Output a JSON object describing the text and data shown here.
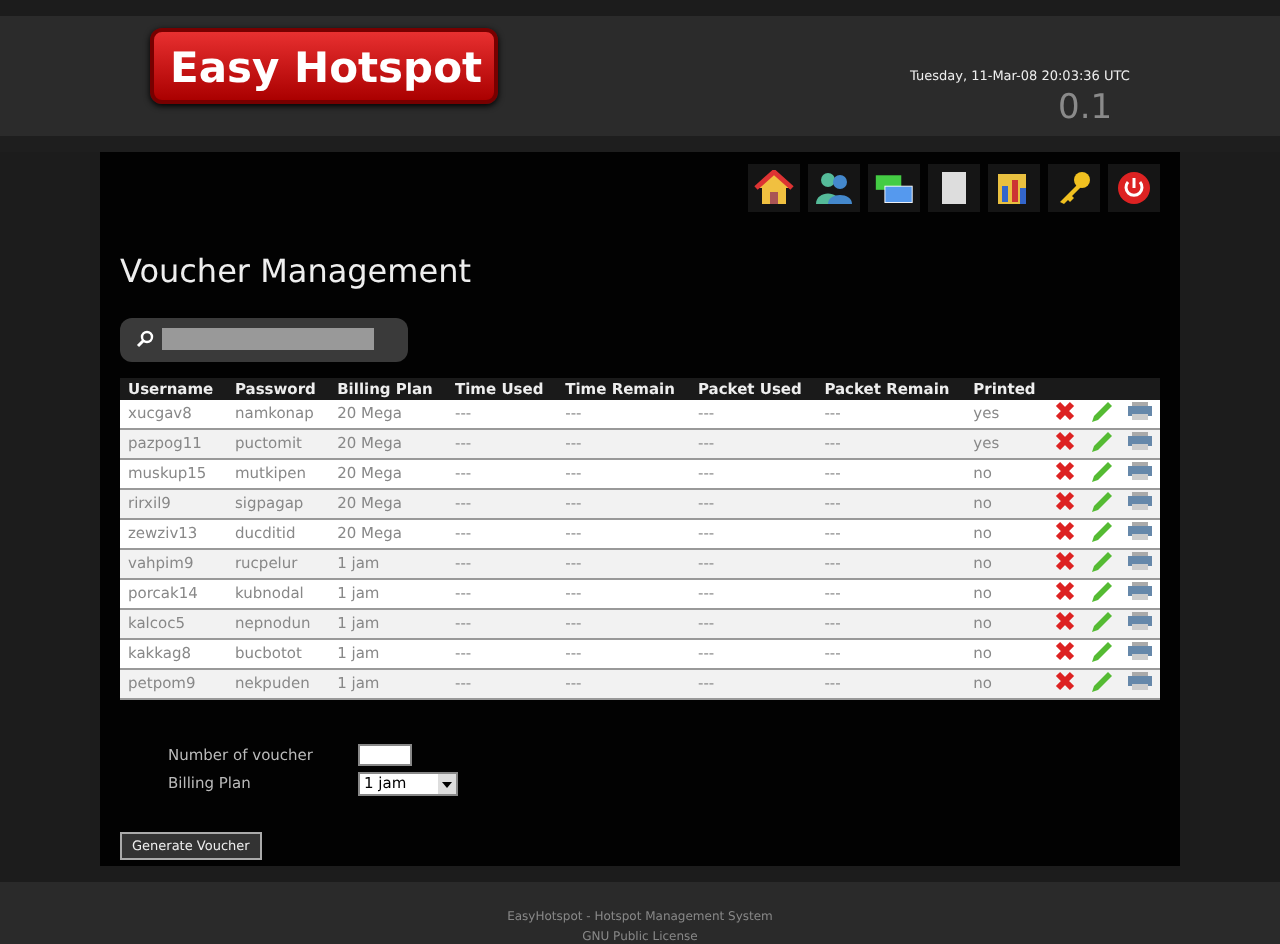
{
  "header": {
    "logo": "Easy Hotspot",
    "datetime": "Tuesday, 11-Mar-08 20:03:36 UTC",
    "version": "0.1"
  },
  "page_title": "Voucher Management",
  "table": {
    "columns": [
      "Username",
      "Password",
      "Billing Plan",
      "Time Used",
      "Time Remain",
      "Packet Used",
      "Packet Remain",
      "Printed"
    ],
    "rows": [
      [
        "xucgav8",
        "namkonap",
        "20 Mega",
        "---",
        "---",
        "---",
        "---",
        "yes"
      ],
      [
        "pazpog11",
        "puctomit",
        "20 Mega",
        "---",
        "---",
        "---",
        "---",
        "yes"
      ],
      [
        "muskup15",
        "mutkipen",
        "20 Mega",
        "---",
        "---",
        "---",
        "---",
        "no"
      ],
      [
        "rirxil9",
        "sigpagap",
        "20 Mega",
        "---",
        "---",
        "---",
        "---",
        "no"
      ],
      [
        "zewziv13",
        "ducditid",
        "20 Mega",
        "---",
        "---",
        "---",
        "---",
        "no"
      ],
      [
        "vahpim9",
        "rucpelur",
        "1 jam",
        "---",
        "---",
        "---",
        "---",
        "no"
      ],
      [
        "porcak14",
        "kubnodal",
        "1 jam",
        "---",
        "---",
        "---",
        "---",
        "no"
      ],
      [
        "kalcoc5",
        "nepnodun",
        "1 jam",
        "---",
        "---",
        "---",
        "---",
        "no"
      ],
      [
        "kakkag8",
        "bucbotot",
        "1 jam",
        "---",
        "---",
        "---",
        "---",
        "no"
      ],
      [
        "petpom9",
        "nekpuden",
        "1 jam",
        "---",
        "---",
        "---",
        "---",
        "no"
      ]
    ]
  },
  "form": {
    "number_label": "Number of voucher",
    "plan_label": "Billing Plan",
    "plan_value": "1 jam",
    "button": "Generate Voucher"
  },
  "footer": [
    "EasyHotspot - Hotspot Management System",
    "GNU Public License"
  ]
}
